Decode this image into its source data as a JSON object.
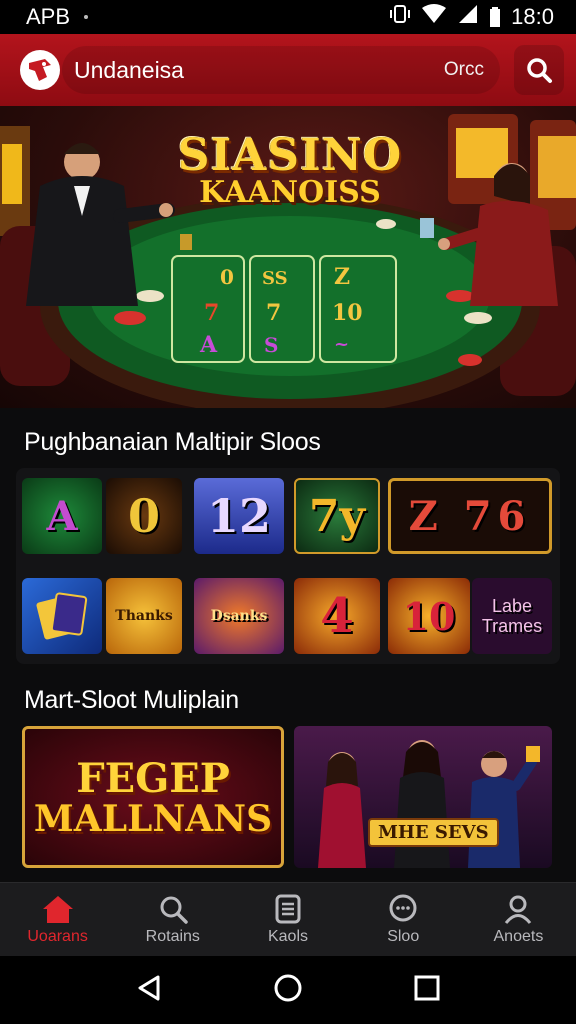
{
  "status_bar": {
    "carrier": "APB",
    "time": "18:0"
  },
  "header": {
    "title": "Undaneisa",
    "option": "Orcc",
    "accent_color": "#b3141c"
  },
  "hero": {
    "line1": "SIASINO",
    "line2": "KAANOISS"
  },
  "section1": {
    "title": "Pughbanaian Maltipir Sloos",
    "row1": [
      "A",
      "0",
      "12",
      "7y",
      "Z 76"
    ],
    "row2": [
      "",
      "Thanks",
      "Dsanks",
      "4",
      "10",
      "Labe Trames"
    ]
  },
  "section2": {
    "title": "Mart-Sloot Muliplain",
    "card1": {
      "line1": "FEGEP",
      "line2": "MALLNANS"
    },
    "card2": {
      "badge": "MHE SEVS"
    }
  },
  "bottom_nav": [
    {
      "label": "Uoarans",
      "icon": "home-icon"
    },
    {
      "label": "Rotains",
      "icon": "search-icon"
    },
    {
      "label": "Kaols",
      "icon": "list-icon"
    },
    {
      "label": "Sloo",
      "icon": "chat-icon"
    },
    {
      "label": "Anoets",
      "icon": "user-icon"
    }
  ]
}
